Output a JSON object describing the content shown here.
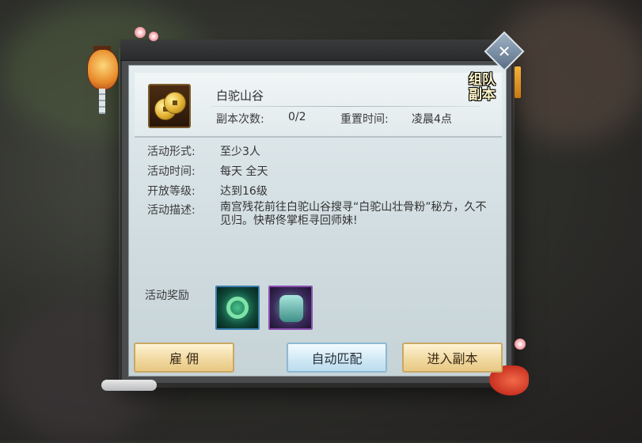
{
  "dungeon": {
    "name": "白驼山谷",
    "count_label": "副本次数:",
    "count_value": "0/2",
    "reset_label": "重置时间:",
    "reset_value": "凌晨4点",
    "badge_line1": "组队",
    "badge_line2": "副本"
  },
  "info": {
    "form_label": "活动形式:",
    "form_value": "至少3人",
    "time_label": "活动时间:",
    "time_value": "每天 全天",
    "level_label": "开放等级:",
    "level_value": "达到16级",
    "desc_label": "活动描述:",
    "desc_value": "南宫残花前往白驼山谷搜寻“白驼山壮骨粉”秘方，久不见归。快帮佟掌柜寻回师妹!"
  },
  "rewards": {
    "label": "活动奖励",
    "items": [
      {
        "icon": "green-jade-bracelet-icon",
        "frame_color": "#3d7fb0"
      },
      {
        "icon": "jade-guardian-charm-icon",
        "frame_color": "#8a4fb2"
      }
    ]
  },
  "buttons": {
    "hire": "雇 佣",
    "auto_match": "自动匹配",
    "enter": "进入副本"
  },
  "icons": {
    "dungeon_icon": "gold-coin-icon",
    "close": "close-icon"
  }
}
